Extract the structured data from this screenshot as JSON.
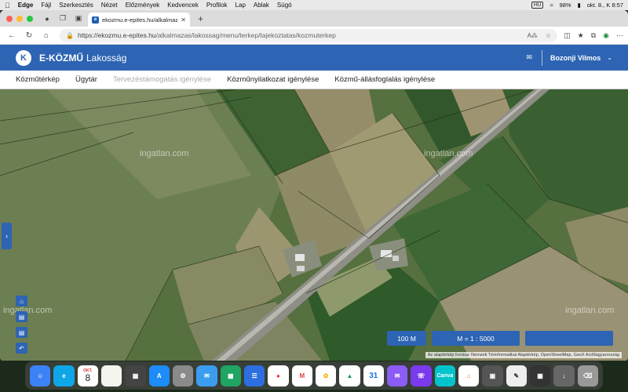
{
  "menubar": {
    "app": "Edge",
    "items": [
      "Fájl",
      "Szerkesztés",
      "Nézet",
      "Előzmények",
      "Kedvencek",
      "Profilok",
      "Lap",
      "Ablak",
      "Súgó"
    ],
    "input_source": "HU",
    "battery": "98%",
    "datetime": "okt. 8., K  8:57"
  },
  "browser": {
    "tab_title": "ekozmu.e-epites.hu/alkalmazas...",
    "url_host": "https://ekozmu.e-epites.hu",
    "url_path": "/alkalmazas/lakossag/menu/terkep/tajekoztatas/kozmuterkep"
  },
  "app": {
    "logo_letter": "K",
    "brand": "E-KÖZMŰ",
    "brand_sub": "Lakosság",
    "user": "Bozonji Vilmos",
    "nav": [
      {
        "label": "Közműtérkép",
        "disabled": false
      },
      {
        "label": "Ügytár",
        "disabled": false
      },
      {
        "label": "Tervezéstámogatás igénylése",
        "disabled": true
      },
      {
        "label": "Közműnyilatkozat igénylése",
        "disabled": false
      },
      {
        "label": "Közmű-állásfoglalás igénylése",
        "disabled": false
      }
    ]
  },
  "map": {
    "watermark": "ingatlan.com",
    "scale_bar": "100 M",
    "scale_ratio": "M = 1 : 5000",
    "attribution": "Az alaptérkép forrása: Nemzeti Térinformatikai Alaptérkép, OpenStreetMap, GeoX ArcMagyarország"
  },
  "dock": {
    "calendar_month": "OKT.",
    "calendar_day": "8",
    "calendar2_day": "31"
  },
  "colors": {
    "brand_blue": "#2d64b3",
    "field_dark": "#3f6534",
    "field_light": "#8a8a64"
  }
}
